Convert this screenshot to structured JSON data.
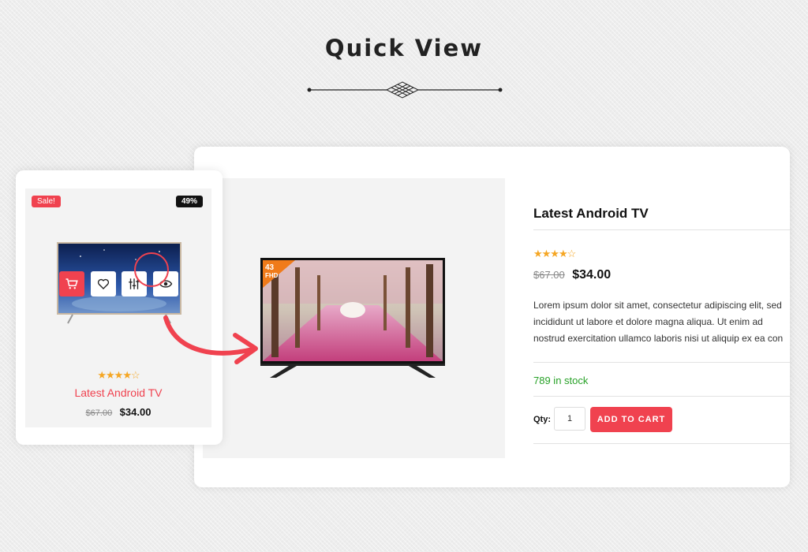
{
  "page": {
    "title": "Quick View"
  },
  "modal": {
    "product_name": "Latest Android TV",
    "rating_stars": "★★★★☆",
    "old_price": "$67.00",
    "new_price": "$34.00",
    "description_lines": [
      "Lorem ipsum dolor sit amet, consectetur adipiscing elit, sed",
      "incididunt ut labore et dolore magna aliqua. Ut enim ad",
      "nostrud exercitation ullamco laboris nisi ut aliquip ex ea con"
    ],
    "stock": "789 in stock",
    "qty_label": "Qty:",
    "qty_value": "1",
    "add_to_cart_label": "ADD TO CART",
    "tv_badge": {
      "line1": "43",
      "line2": "FHD"
    }
  },
  "card": {
    "sale_badge": "Sale!",
    "discount_badge": "49%",
    "rating_stars": "★★★★☆",
    "product_name": "Latest Android TV",
    "old_price": "$67.00",
    "new_price": "$34.00",
    "actions": [
      "cart-icon",
      "heart-icon",
      "compare-icon",
      "eye-icon"
    ]
  },
  "colors": {
    "accent": "#f0424f",
    "stock": "#27a127",
    "star": "#f5a623"
  }
}
